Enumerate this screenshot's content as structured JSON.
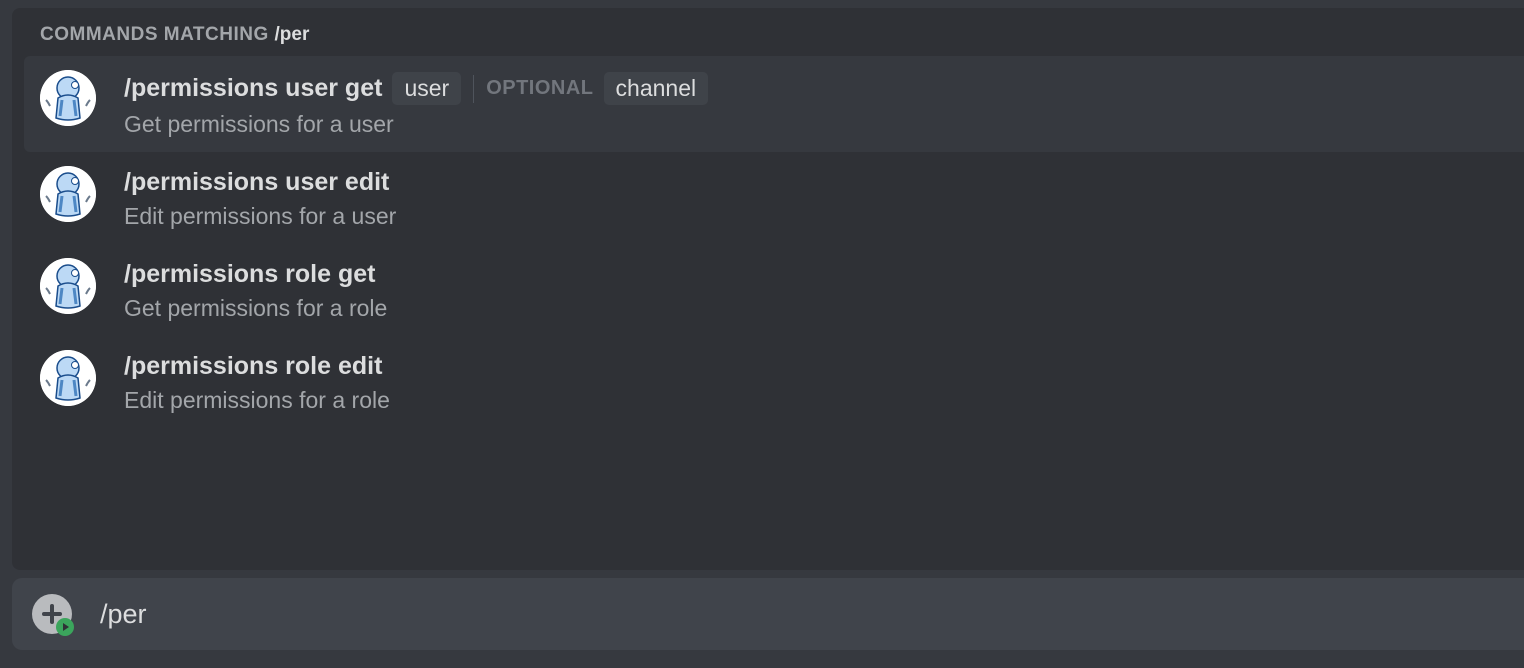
{
  "header": {
    "label": "COMMANDS MATCHING ",
    "query": "/per"
  },
  "commands": [
    {
      "name": "/permissions user get",
      "desc": "Get permissions for a user",
      "params_required": [
        "user"
      ],
      "optional_label": "OPTIONAL",
      "params_optional": [
        "channel"
      ],
      "selected": true
    },
    {
      "name": "/permissions user edit",
      "desc": "Edit permissions for a user",
      "params_required": [],
      "params_optional": [],
      "selected": false
    },
    {
      "name": "/permissions role get",
      "desc": "Get permissions for a role",
      "params_required": [],
      "params_optional": [],
      "selected": false
    },
    {
      "name": "/permissions role edit",
      "desc": "Edit permissions for a role",
      "params_required": [],
      "params_optional": [],
      "selected": false
    }
  ],
  "input": {
    "value": "/per"
  }
}
